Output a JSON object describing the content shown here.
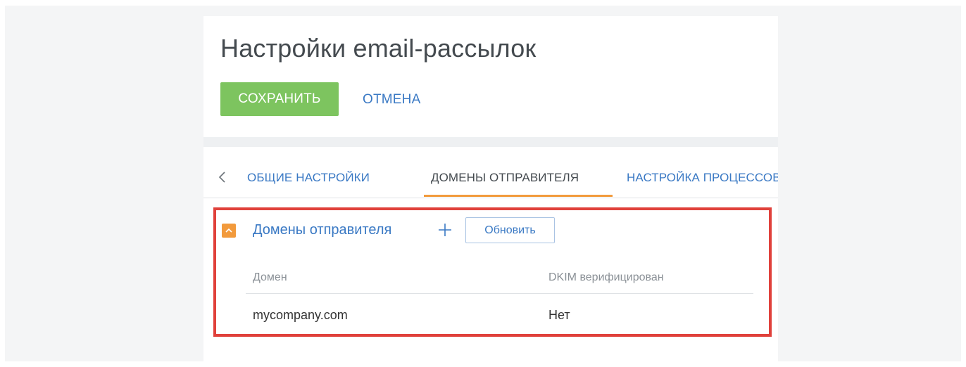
{
  "page": {
    "title": "Настройки email-рассылок"
  },
  "toolbar": {
    "save_label": "СОХРАНИТЬ",
    "cancel_label": "ОТМЕНА"
  },
  "tabs": [
    {
      "label": "ОБЩИЕ НАСТРОЙКИ",
      "active": false
    },
    {
      "label": "ДОМЕНЫ ОТПРАВИТЕЛЯ",
      "active": true
    },
    {
      "label": "НАСТРОЙКА ПРОЦЕССОВ",
      "active": false
    }
  ],
  "detail": {
    "title": "Домены отправителя",
    "refresh_label": "Обновить",
    "columns": [
      "Домен",
      "DKIM верифицирован"
    ],
    "rows": [
      {
        "domain": "mycompany.com",
        "dkim": "Нет"
      }
    ]
  },
  "icons": {
    "back": "chevron-left-icon",
    "collapse": "chevron-up-icon",
    "add": "plus-icon"
  },
  "colors": {
    "accent_green": "#7dc45f",
    "link_blue": "#3a79c4",
    "tab_active": "#f29a3c",
    "highlight": "#e0413b"
  }
}
